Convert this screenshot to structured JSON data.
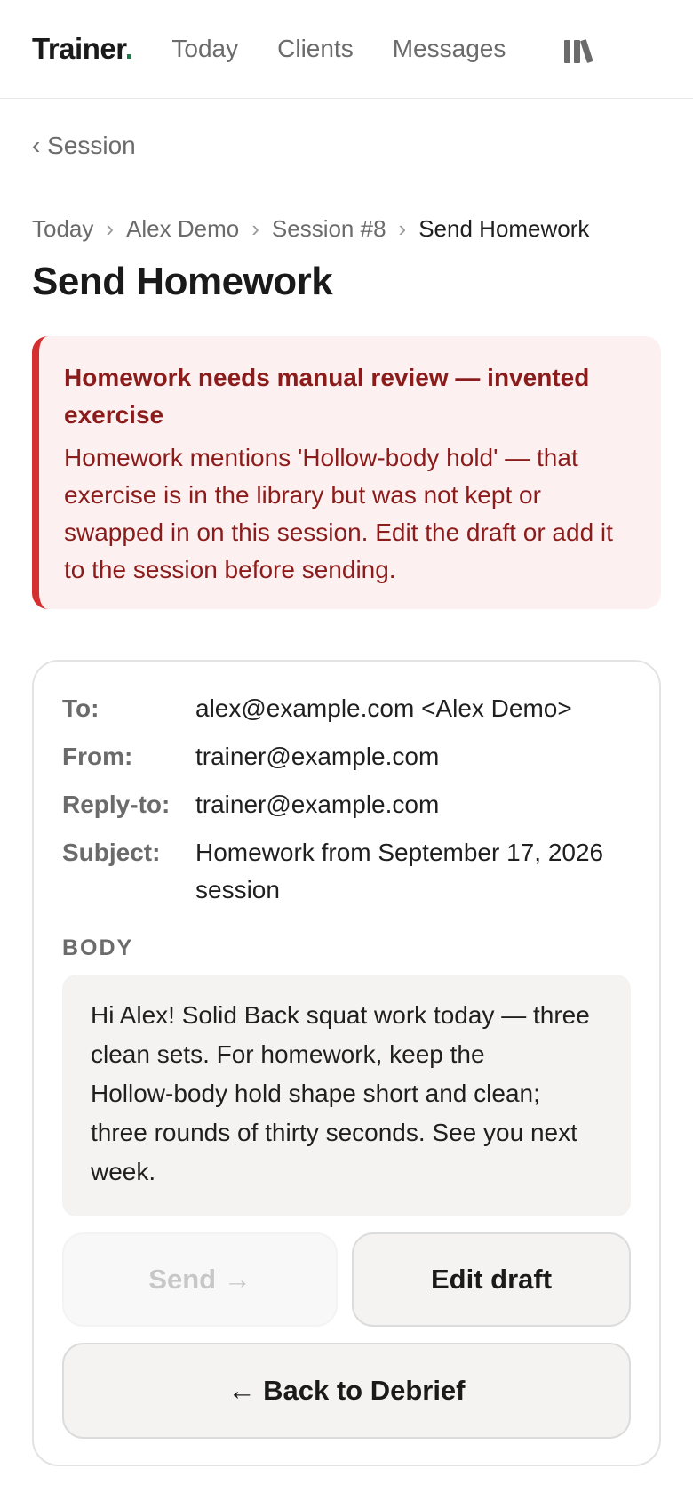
{
  "topbar": {
    "brand": "Trainer",
    "brand_dot": ".",
    "nav": [
      {
        "label": "Today"
      },
      {
        "label": "Clients"
      },
      {
        "label": "Messages"
      }
    ],
    "library_icon": "library-icon"
  },
  "back_link": "‹ Session",
  "breadcrumb": {
    "items": [
      "Today",
      "Alex Demo",
      "Session #8"
    ],
    "current": "Send Homework",
    "separator": "›"
  },
  "page_title": "Send Homework",
  "alert": {
    "title": "Homework needs manual review — invented exercise",
    "body": "Homework mentions 'Hollow‑body hold' — that exercise is in the library but was not kept or swapped in on this session. Edit the draft or add it to the session before sending.",
    "color": "#d62f2f"
  },
  "email": {
    "to_label": "To:",
    "to": "alex@example.com <Alex Demo>",
    "from_label": "From:",
    "from": "trainer@example.com",
    "reply_label": "Reply‑to:",
    "reply_to": "trainer@example.com",
    "subject_label": "Subject:",
    "subject": "Homework from September 17, 2026 session",
    "body_label": "BODY",
    "body": "Hi Alex! Solid Back squat work today — three clean sets. For homework, keep the Hollow‑body hold shape short and clean; three rounds of thirty seconds. See you next week."
  },
  "actions": {
    "send": "Send →",
    "edit": "Edit draft",
    "back": "← Back to Debrief"
  }
}
